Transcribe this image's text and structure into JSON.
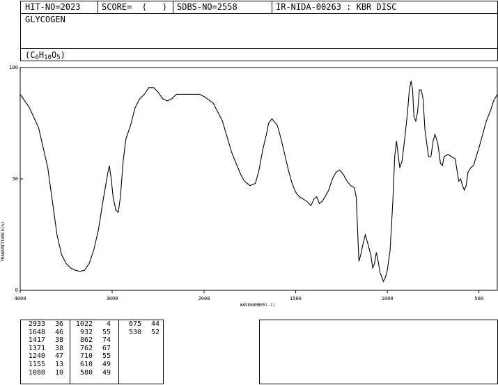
{
  "header": {
    "hit_no": "HIT-NO=2023",
    "score": "SCORE=  (   )",
    "sdbs_no": "SDBS-NO=2558",
    "ir_id": "IR-NIDA-00263 : KBR DISC",
    "compound": "GLYCOGEN",
    "formula_parts": [
      "(C",
      "6",
      "H",
      "10",
      "O",
      "5",
      ")"
    ]
  },
  "chart_data": {
    "type": "line",
    "title": "",
    "xlabel": "WAVENUMBER(-1)",
    "ylabel": "TRANSMITTANCE(%)",
    "xlim": [
      4000,
      400
    ],
    "ylim": [
      0,
      100
    ],
    "x_ticks": [
      4000,
      3000,
      2000,
      1500,
      1000,
      500
    ],
    "y_ticks": [
      0,
      50,
      100
    ],
    "grid": false,
    "series": [
      {
        "x": [
          4000,
          3900,
          3800,
          3700,
          3650,
          3600,
          3550,
          3500,
          3450,
          3400,
          3350,
          3300,
          3250,
          3200,
          3150,
          3100,
          3050,
          3030,
          3010,
          2990,
          2960,
          2933,
          2910,
          2880,
          2850,
          2800,
          2750,
          2700,
          2650,
          2600,
          2550,
          2500,
          2450,
          2400,
          2350,
          2300,
          2250,
          2200,
          2150,
          2100,
          2050,
          2000,
          1950,
          1900,
          1850,
          1800,
          1780,
          1750,
          1720,
          1700,
          1680,
          1660,
          1648,
          1630,
          1600,
          1580,
          1560,
          1540,
          1520,
          1500,
          1480,
          1460,
          1440,
          1417,
          1400,
          1385,
          1371,
          1355,
          1340,
          1320,
          1300,
          1280,
          1260,
          1240,
          1220,
          1200,
          1180,
          1170,
          1155,
          1145,
          1135,
          1120,
          1110,
          1100,
          1090,
          1080,
          1070,
          1060,
          1050,
          1040,
          1030,
          1022,
          1010,
          1000,
          985,
          970,
          960,
          950,
          940,
          932,
          920,
          905,
          890,
          880,
          870,
          862,
          855,
          845,
          835,
          825,
          815,
          805,
          795,
          785,
          775,
          762,
          750,
          740,
          725,
          710,
          700,
          690,
          670,
          650,
          630,
          610,
          600,
          590,
          580,
          570,
          560,
          545,
          530,
          515,
          500,
          480,
          460,
          440,
          420,
          400
        ],
        "y": [
          88,
          82,
          73,
          55,
          40,
          25,
          16,
          12,
          10,
          9,
          8.5,
          9,
          12,
          18,
          27,
          40,
          52,
          56,
          50,
          42,
          36,
          35,
          42,
          58,
          68,
          74,
          82,
          86,
          88,
          91,
          91,
          89,
          86,
          85,
          86,
          88,
          88,
          88,
          88,
          88,
          88,
          87,
          84,
          76,
          62,
          52,
          49,
          47,
          48,
          54,
          63,
          70,
          75,
          77,
          74,
          68,
          61,
          54,
          48,
          44,
          42,
          41,
          40,
          38,
          41,
          42,
          39,
          40,
          42,
          45,
          50,
          53,
          54,
          52,
          49,
          47,
          46,
          42,
          13,
          16,
          20,
          25,
          22,
          19,
          16,
          10,
          12,
          17,
          13,
          8,
          6,
          4,
          6,
          9,
          18,
          40,
          60,
          67,
          60,
          55,
          58,
          68,
          80,
          90,
          94,
          90,
          78,
          76,
          80,
          90,
          90,
          86,
          72,
          66,
          60,
          60,
          67,
          70,
          66,
          57,
          56,
          60,
          61,
          60,
          59,
          49,
          50,
          47,
          45,
          47,
          53,
          55,
          56,
          60,
          64,
          70,
          76,
          80,
          85,
          88
        ]
      }
    ]
  },
  "peak_table": {
    "columns": [
      [
        [
          "2933",
          "36"
        ],
        [
          "1648",
          "46"
        ],
        [
          "1417",
          "38"
        ],
        [
          "1371",
          "38"
        ],
        [
          "1240",
          "47"
        ],
        [
          "1155",
          "13"
        ],
        [
          "1080",
          "10"
        ]
      ],
      [
        [
          "1022",
          "4"
        ],
        [
          "932",
          "55"
        ],
        [
          "862",
          "74"
        ],
        [
          "762",
          "67"
        ],
        [
          "710",
          "55"
        ],
        [
          "610",
          "49"
        ],
        [
          "580",
          "49"
        ]
      ],
      [
        [
          "675",
          "44"
        ],
        [
          "530",
          "52"
        ]
      ]
    ]
  }
}
